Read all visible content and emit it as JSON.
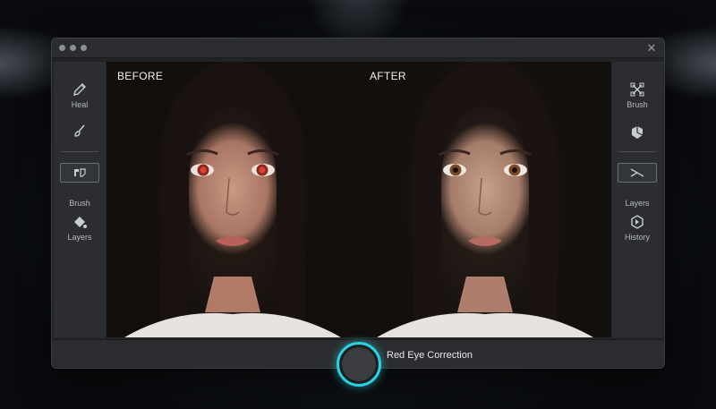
{
  "window": {
    "close_glyph": "✕"
  },
  "left_toolbar": {
    "items": [
      {
        "label": "Heal",
        "icon": "pencil-icon"
      },
      {
        "label": "",
        "icon": "brush-icon"
      },
      {
        "label": "",
        "icon": "selection-icon"
      },
      {
        "label": "Brush",
        "icon": "paint-bucket-icon"
      },
      {
        "label": "Layers",
        "icon": "layers-icon"
      }
    ]
  },
  "right_toolbar": {
    "items": [
      {
        "label": "Brush",
        "icon": "crosshair-icon"
      },
      {
        "label": "",
        "icon": "cube-icon"
      },
      {
        "label": "Layers",
        "icon": "scissors-icon"
      },
      {
        "label": "History",
        "icon": "history-icon"
      }
    ]
  },
  "comparison": {
    "before_label": "BEFORE",
    "after_label": "AFTER"
  },
  "action": {
    "label": "Red Eye Correction"
  },
  "colors": {
    "accent": "#2ad1e0",
    "red_eye": "#c0392b",
    "corrected_eye": "#7a4a2a"
  }
}
